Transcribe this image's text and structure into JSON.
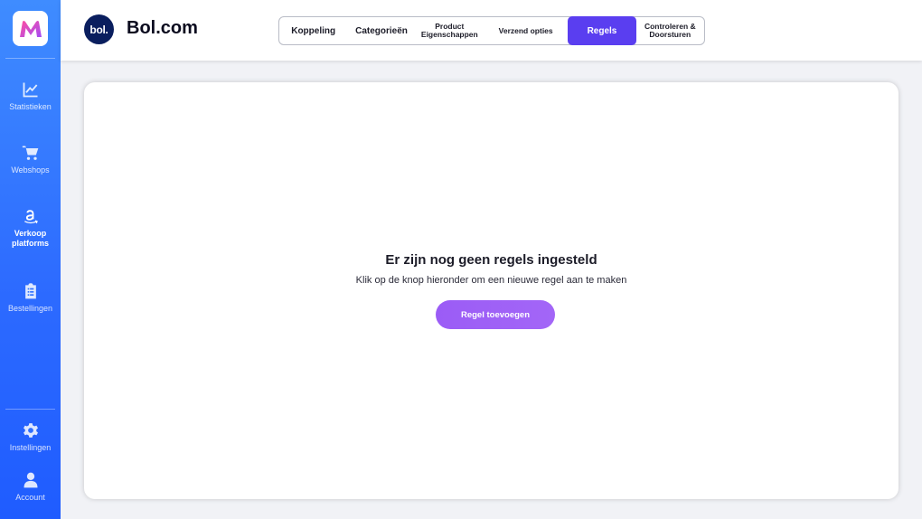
{
  "sidebar": {
    "logo_icon": "m-logo-icon",
    "items": [
      {
        "label": "Statistieken",
        "icon": "chart-line-icon",
        "active": false
      },
      {
        "label": "Webshops",
        "icon": "cart-icon",
        "active": false
      },
      {
        "label": "Verkoop platforms",
        "icon": "amazon-icon",
        "active": true
      },
      {
        "label": "Bestellingen",
        "icon": "clipboard-list-icon",
        "active": false
      }
    ],
    "bottom_items": [
      {
        "label": "Instellingen",
        "icon": "gear-icon"
      },
      {
        "label": "Account",
        "icon": "user-icon"
      }
    ]
  },
  "header": {
    "brand_logo_text": "bol.",
    "brand_name": "Bol.com",
    "tabs": [
      {
        "label": "Koppeling",
        "active": false
      },
      {
        "label": "Categorieën",
        "active": false
      },
      {
        "label": "Product Eigenschappen",
        "active": false
      },
      {
        "label": "Verzend opties",
        "active": false
      },
      {
        "label": "Regels",
        "active": true
      },
      {
        "label": "Controleren & Doorsturen",
        "active": false
      }
    ]
  },
  "main": {
    "empty_title": "Er zijn nog geen regels ingesteld",
    "empty_subtitle": "Klik op de knop hieronder om een nieuwe regel aan te maken",
    "add_button_label": "Regel toevoegen"
  },
  "colors": {
    "sidebar_gradient_top": "#3f8cff",
    "sidebar_gradient_bottom": "#1f5cff",
    "active_tab": "#5a3ef0",
    "button_purple": "#9b5cf6",
    "brand_navy": "#0a1e5e"
  }
}
